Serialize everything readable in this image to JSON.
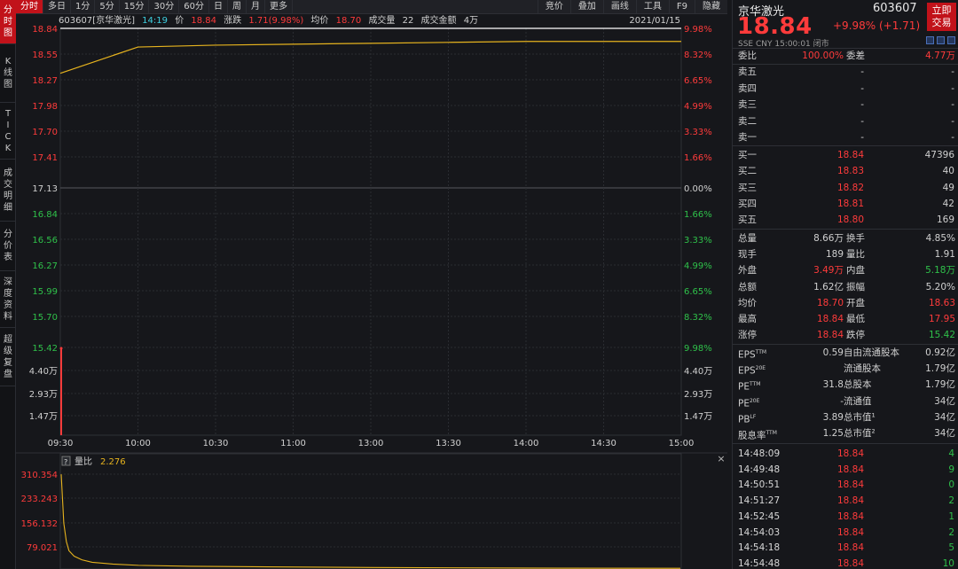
{
  "left_tabs": [
    {
      "label": "分时图",
      "chars": [
        "分",
        "时",
        "图"
      ],
      "active": true
    },
    {
      "label": "K线图",
      "chars": [
        "K",
        "线",
        "图"
      ],
      "active": false
    },
    {
      "label": "TICK",
      "chars": [
        "T",
        "I",
        "C",
        "K"
      ],
      "active": false
    },
    {
      "label": "成交明细",
      "chars": [
        "成",
        "交",
        "明",
        "细"
      ],
      "active": false
    },
    {
      "label": "分价表",
      "chars": [
        "分",
        "价",
        "表"
      ],
      "active": false
    },
    {
      "label": "深度资料",
      "chars": [
        "深",
        "度",
        "资",
        "料"
      ],
      "active": false
    },
    {
      "label": "超级复盘",
      "chars": [
        "超",
        "级",
        "复",
        "盘"
      ],
      "active": false
    }
  ],
  "top_tabs": [
    "分时",
    "多日",
    "1分",
    "5分",
    "15分",
    "30分",
    "60分",
    "日",
    "周",
    "月",
    "更多"
  ],
  "top_right": [
    "竞价",
    "叠加",
    "画线",
    "工具",
    "F9",
    "隐藏"
  ],
  "info": {
    "code_name": "603607[京华激光]",
    "time": "14:19",
    "price_label": "价",
    "price": "18.84",
    "chg_label": "涨跌",
    "chg": "1.71(9.98%)",
    "avg_label": "均价",
    "avg": "18.70",
    "vol_label": "成交量",
    "vol": "22",
    "amt_label": "成交金额",
    "amt": "4万",
    "date": "2021/01/15"
  },
  "chart_data": [
    {
      "type": "line",
      "name": "price",
      "x_ticks": [
        "09:30",
        "10:00",
        "10:30",
        "11:00",
        "13:00",
        "13:30",
        "14:00",
        "14:30",
        "15:00"
      ],
      "y_left_ticks": [
        "18.84",
        "18.55",
        "18.27",
        "17.98",
        "17.70",
        "17.41",
        "17.13",
        "16.84",
        "16.56",
        "16.27",
        "15.99",
        "15.70",
        "15.42"
      ],
      "y_right_ticks": [
        "9.98%",
        "8.32%",
        "6.65%",
        "4.99%",
        "3.33%",
        "1.66%",
        "0.00%",
        "1.66%",
        "3.33%",
        "4.99%",
        "6.65%",
        "8.32%",
        "9.98%"
      ],
      "ylim": [
        15.42,
        18.84
      ],
      "prev_close": 17.13,
      "price_series": [
        18.84,
        18.84,
        18.84,
        18.84,
        18.84,
        18.84,
        18.84,
        18.84,
        18.84
      ],
      "avg_series": [
        18.53,
        18.64,
        18.66,
        18.67,
        18.68,
        18.69,
        18.7,
        18.7,
        18.7
      ],
      "vol_left_ticks": [
        "4.40万",
        "2.93万",
        "1.47万"
      ],
      "vol_right_ticks": [
        "4.40万",
        "2.93万",
        "1.47万"
      ]
    },
    {
      "type": "line",
      "name": "volume ratio",
      "label": "量比",
      "current": "2.276",
      "y_ticks": [
        "310.354",
        "233.243",
        "156.132",
        "79.021"
      ],
      "ylim": [
        0,
        310.354
      ],
      "x": [
        0,
        1,
        2,
        3,
        5,
        8,
        12,
        20,
        30,
        50,
        80,
        120,
        180,
        240
      ],
      "values": [
        310,
        150,
        90,
        60,
        42,
        30,
        22,
        16,
        12,
        9,
        7,
        5,
        3,
        2.3
      ]
    }
  ],
  "quote": {
    "name": "京华激光",
    "code": "603607",
    "trade_btn": [
      "立即",
      "交易"
    ],
    "price": "18.84",
    "change": "+9.98% (+1.71)",
    "sub": "SSE  CNY  15:00:01  闭市",
    "weibi_label": "委比",
    "weibi": "100.00%",
    "weicha_label": "委差",
    "weicha": "4.77万",
    "asks": [
      {
        "l": "卖五",
        "p": "-",
        "v": "-"
      },
      {
        "l": "卖四",
        "p": "-",
        "v": "-"
      },
      {
        "l": "卖三",
        "p": "-",
        "v": "-"
      },
      {
        "l": "卖二",
        "p": "-",
        "v": "-"
      },
      {
        "l": "卖一",
        "p": "-",
        "v": "-"
      }
    ],
    "bids": [
      {
        "l": "买一",
        "p": "18.84",
        "v": "47396"
      },
      {
        "l": "买二",
        "p": "18.83",
        "v": "40"
      },
      {
        "l": "买三",
        "p": "18.82",
        "v": "49"
      },
      {
        "l": "买四",
        "p": "18.81",
        "v": "42"
      },
      {
        "l": "买五",
        "p": "18.80",
        "v": "169"
      }
    ],
    "stats": [
      {
        "a": "总量",
        "b": "8.66万",
        "bc": "w",
        "c": "换手",
        "d": "4.85%",
        "dc": "w"
      },
      {
        "a": "现手",
        "b": "189",
        "bc": "w",
        "c": "量比",
        "d": "1.91",
        "dc": "w"
      },
      {
        "a": "外盘",
        "b": "3.49万",
        "bc": "r",
        "c": "内盘",
        "d": "5.18万",
        "dc": "g"
      },
      {
        "a": "总额",
        "b": "1.62亿",
        "bc": "w",
        "c": "振幅",
        "d": "5.20%",
        "dc": "w"
      },
      {
        "a": "均价",
        "b": "18.70",
        "bc": "r",
        "c": "开盘",
        "d": "18.63",
        "dc": "r"
      },
      {
        "a": "最高",
        "b": "18.84",
        "bc": "r",
        "c": "最低",
        "d": "17.95",
        "dc": "r"
      },
      {
        "a": "涨停",
        "b": "18.84",
        "bc": "r",
        "c": "跌停",
        "d": "15.42",
        "dc": "g"
      }
    ],
    "fin": [
      {
        "a": "EPS",
        "sup": "TTM",
        "b": "0.59",
        "c": "自由流通股本",
        "d": "0.92亿"
      },
      {
        "a": "EPS",
        "sup": "20E",
        "b": "",
        "c": "流通股本",
        "d": "1.79亿"
      },
      {
        "a": "PE",
        "sup": "TTM",
        "b": "31.8",
        "c": "总股本",
        "d": "1.79亿"
      },
      {
        "a": "PE",
        "sup": "20E",
        "b": "-",
        "c": "流通值",
        "d": "34亿"
      },
      {
        "a": "PB",
        "sup": "LF",
        "b": "3.89",
        "c": "总市值¹",
        "d": "34亿"
      },
      {
        "a": "股息率",
        "sup": "TTM",
        "b": "1.25",
        "c": "总市值²",
        "d": "34亿"
      }
    ],
    "trades": [
      {
        "t": "14:48:09",
        "p": "18.84",
        "v": "4"
      },
      {
        "t": "14:49:48",
        "p": "18.84",
        "v": "9"
      },
      {
        "t": "14:50:51",
        "p": "18.84",
        "v": "0"
      },
      {
        "t": "14:51:27",
        "p": "18.84",
        "v": "2"
      },
      {
        "t": "14:52:45",
        "p": "18.84",
        "v": "1"
      },
      {
        "t": "14:54:03",
        "p": "18.84",
        "v": "2"
      },
      {
        "t": "14:54:18",
        "p": "18.84",
        "v": "5"
      },
      {
        "t": "14:54:48",
        "p": "18.84",
        "v": "10"
      }
    ]
  },
  "colors": {
    "up": "#ff3b3b",
    "down": "#2fc14a",
    "avg_line": "#e6b31e",
    "price_line": "#ffffff",
    "accent": "#c1121a"
  }
}
